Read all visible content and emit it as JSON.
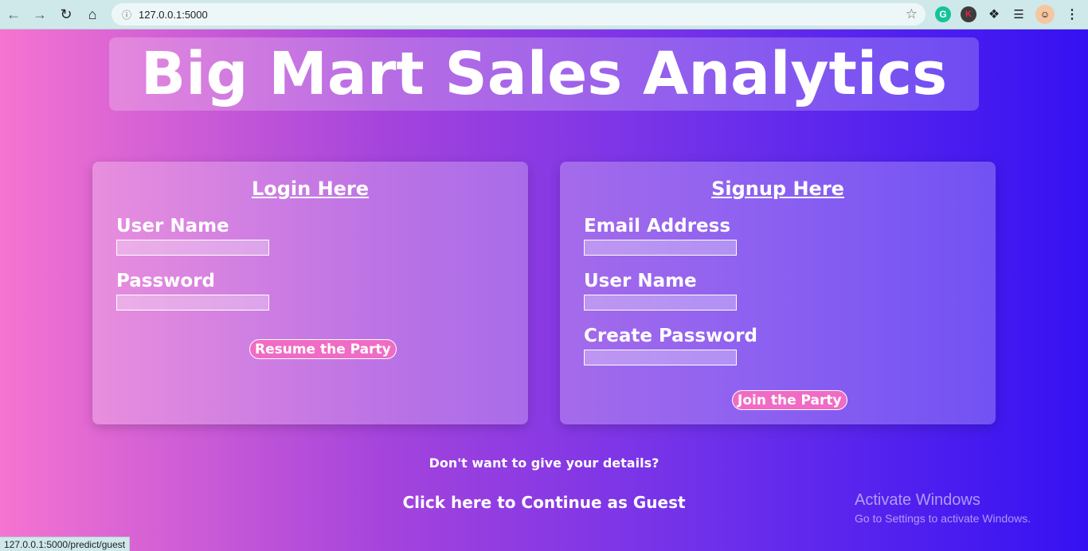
{
  "browser": {
    "url": "127.0.0.1:5000",
    "status_url": "127.0.0.1:5000/predict/guest",
    "icons": {
      "back": "back-arrow-icon",
      "forward": "forward-arrow-icon",
      "reload": "reload-icon",
      "home": "home-icon",
      "info": "info-icon",
      "star": "star-icon",
      "grammarly": "grammarly-icon",
      "extension_k": "k-extension-icon",
      "extensions": "puzzle-icon",
      "media": "media-list-icon",
      "profile": "avatar",
      "menu": "kebab-menu-icon"
    }
  },
  "header": {
    "title": "Big Mart Sales Analytics"
  },
  "login": {
    "heading": "Login Here",
    "username_label": "User Name",
    "password_label": "Password",
    "submit_label": "Resume the Party"
  },
  "signup": {
    "heading": "Signup Here",
    "email_label": "Email Address",
    "username_label": "User Name",
    "password_label": "Create Password",
    "submit_label": "Join the Party"
  },
  "guest": {
    "question": "Don't want to give your details?",
    "link": "Click here to Continue as Guest"
  },
  "watermark": {
    "line1": "Activate Windows",
    "line2": "Go to Settings to activate Windows."
  },
  "colors": {
    "gradient_start": "#f574d0",
    "gradient_end": "#3511f2",
    "button_pink": "#f06cc4"
  }
}
